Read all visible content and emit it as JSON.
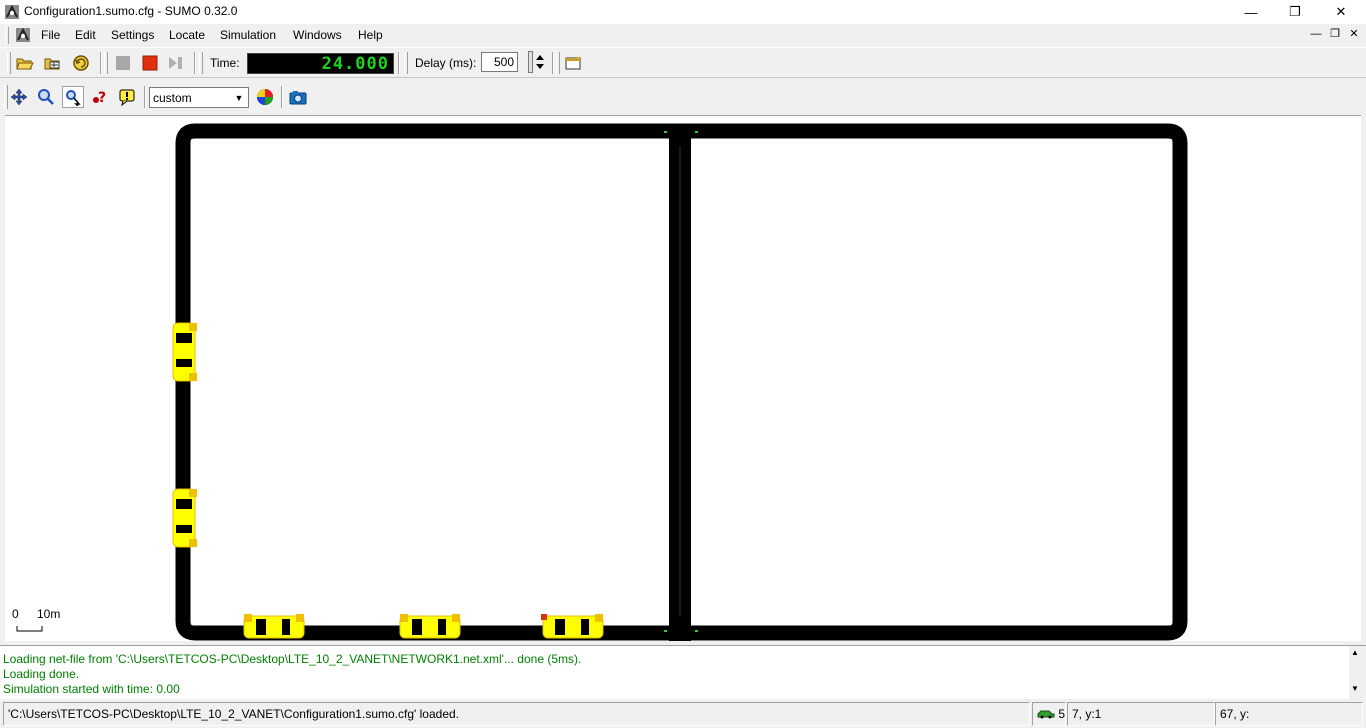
{
  "window": {
    "title": "Configuration1.sumo.cfg - SUMO 0.32.0",
    "minimize": "—",
    "maximize": "❐",
    "close": "✕"
  },
  "menu": {
    "items": [
      "File",
      "Edit",
      "Settings",
      "Locate",
      "Simulation",
      "Windows",
      "Help"
    ]
  },
  "toolbar": {
    "time_label": "Time:",
    "time_value": "24.000",
    "delay_label": "Delay (ms):",
    "delay_value": "500",
    "scheme_value": "custom"
  },
  "canvas": {
    "scale_zero": "0",
    "scale_label": "10m",
    "vehicle_color": "#ffff00",
    "road_color": "#000000"
  },
  "log": {
    "lines": [
      "Loading net-file from 'C:\\Users\\TETCOS-PC\\Desktop\\LTE_10_2_VANET\\NETWORK1.net.xml'... done (5ms).",
      "Loading done.",
      "Simulation started with time: 0.00"
    ],
    "color": "#008000"
  },
  "status": {
    "message": "'C:\\Users\\TETCOS-PC\\Desktop\\LTE_10_2_VANET\\Configuration1.sumo.cfg' loaded.",
    "vehicle_count": "5",
    "coords_1": "7, y:1",
    "coords_2": "67, y:"
  }
}
